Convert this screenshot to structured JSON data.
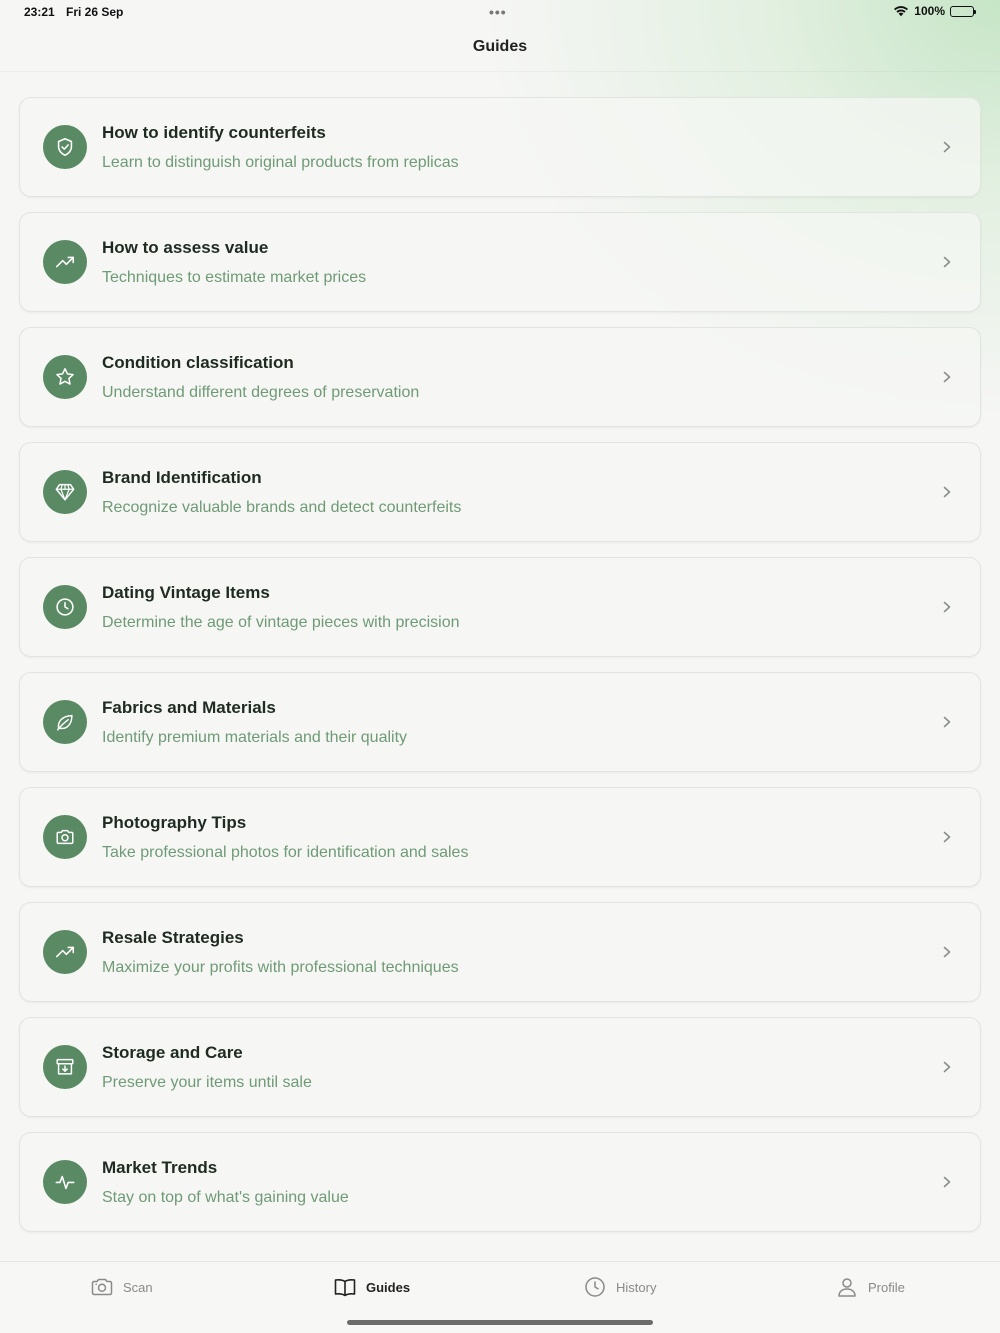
{
  "status": {
    "time": "23:21",
    "date": "Fri 26 Sep",
    "dots": "•••",
    "battery": "100%"
  },
  "nav": {
    "title": "Guides"
  },
  "colors": {
    "accent": "#5a8a64",
    "subtitle": "#6f9a76"
  },
  "guides": [
    {
      "icon": "shield-check-icon",
      "title": "How to identify counterfeits",
      "subtitle": "Learn to distinguish original products from replicas"
    },
    {
      "icon": "trending-up-icon",
      "title": "How to assess value",
      "subtitle": "Techniques to estimate market prices"
    },
    {
      "icon": "star-icon",
      "title": "Condition classification",
      "subtitle": "Understand different degrees of preservation"
    },
    {
      "icon": "diamond-icon",
      "title": "Brand Identification",
      "subtitle": "Recognize valuable brands and detect counterfeits"
    },
    {
      "icon": "clock-icon",
      "title": "Dating Vintage Items",
      "subtitle": "Determine the age of vintage pieces with precision"
    },
    {
      "icon": "leaf-icon",
      "title": "Fabrics and Materials",
      "subtitle": "Identify premium materials and their quality"
    },
    {
      "icon": "camera-icon",
      "title": "Photography Tips",
      "subtitle": "Take professional photos for identification and sales"
    },
    {
      "icon": "trending-up-icon",
      "title": "Resale Strategies",
      "subtitle": "Maximize your profits with professional techniques"
    },
    {
      "icon": "archive-icon",
      "title": "Storage and Care",
      "subtitle": "Preserve your items until sale"
    },
    {
      "icon": "activity-icon",
      "title": "Market Trends",
      "subtitle": "Stay on top of what's gaining value"
    }
  ],
  "tabs": [
    {
      "icon": "camera-icon",
      "label": "Scan",
      "active": false
    },
    {
      "icon": "book-open-icon",
      "label": "Guides",
      "active": true
    },
    {
      "icon": "clock-icon",
      "label": "History",
      "active": false
    },
    {
      "icon": "user-icon",
      "label": "Profile",
      "active": false
    }
  ]
}
